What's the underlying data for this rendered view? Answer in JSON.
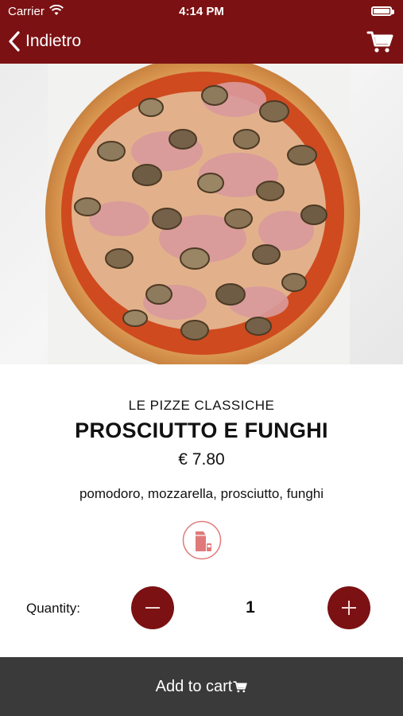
{
  "status_bar": {
    "carrier": "Carrier",
    "time": "4:14 PM"
  },
  "nav": {
    "back_label": "Indietro",
    "back_icon": "chevron-left-icon",
    "cart_icon": "cart-icon"
  },
  "product": {
    "category": "LE PIZZE CLASSICHE",
    "name": "PROSCIUTTO E FUNGHI",
    "price": "€ 7.80",
    "ingredients": "pomodoro, mozzarella, prosciutto, funghi",
    "badge_icon": "milk-carton-icon"
  },
  "quantity": {
    "label": "Quantity:",
    "value": "1"
  },
  "cta": {
    "label": "Add to cart",
    "icon": "cart-icon"
  },
  "colors": {
    "brand": "#7b1113",
    "cta_background": "#3a3a3a",
    "badge": "#e07a7a"
  }
}
